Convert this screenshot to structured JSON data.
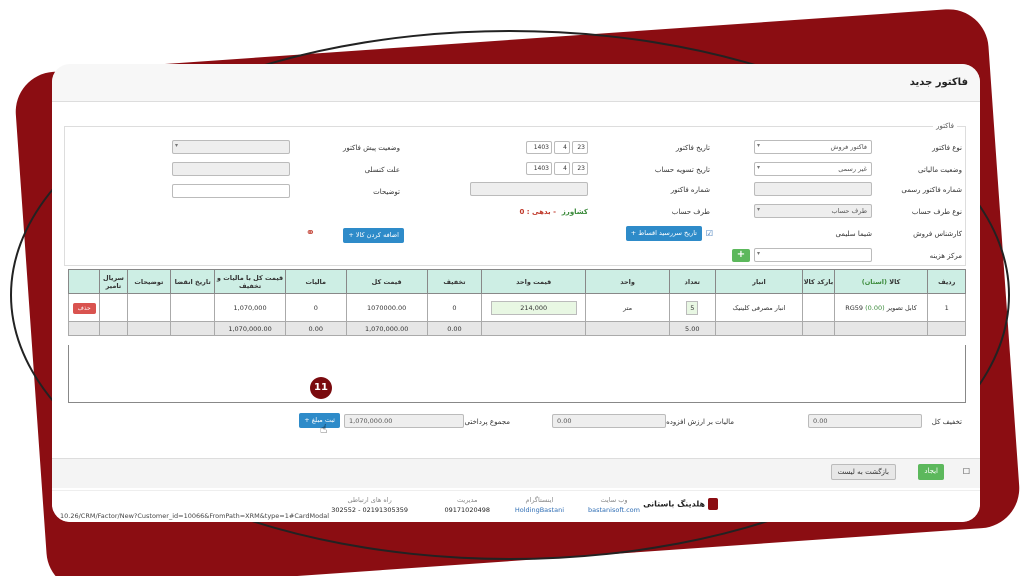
{
  "title": "فاکتور جدید",
  "section_legend": "فاکتور",
  "form": {
    "invoice_type_label": "نوع فاکتور",
    "invoice_type_value": "فاکتور فروش",
    "tax_status_label": "وضعیت مالیاتی",
    "tax_status_value": "غیر رسمی",
    "official_number_label": "شماره فاکتور رسمی",
    "party_type_label": "نوع طرف حساب",
    "party_type_value": "طرف حساب",
    "sales_expert_label": "کارشناس فروش",
    "sales_expert_value": "شیما سلیمی",
    "cost_center_label": "مرکز هزینه",
    "invoice_date_label": "تاریخ فاکتور",
    "settle_date_label": "تاریخ تسویه حساب",
    "invoice_number_label": "شماره فاکتور",
    "party_label": "طرف حساب",
    "party_value": "کشاورز",
    "party_debt": "- بدهی : 0",
    "date_day": "23",
    "date_month": "4",
    "date_year": "1403",
    "installment_button": "تاریخ سررسید اقساط",
    "pre_invoice_status_label": "وضعیت پیش فاکتور",
    "cancel_reason_label": "علت کنسلی",
    "description_label": "توضیحات",
    "add_credit_button": "اضافه کردن کالا"
  },
  "table": {
    "headers": [
      "ردیف",
      "کالا",
      "بارکد کالا",
      "انبار",
      "تعداد",
      "واحد",
      "قیمت واحد",
      "تخفیف",
      "قیمت کل",
      "مالیات",
      "قیمت کل با مالیات و تخفیف",
      "تاریخ انقضا",
      "توضیحات",
      "سریال تامیر"
    ],
    "row": {
      "index": "1",
      "product": "کابل تصویر RG59",
      "stock": "(0.00)",
      "stock_header": "(استان)",
      "warehouse": "انبار مصرفی کلینیک",
      "qty": "5",
      "unit": "متر",
      "unit_price": "214,000",
      "discount": "0",
      "total": "1070000.00",
      "tax": "0",
      "grand_total": "1,070,000",
      "delete": "حذف"
    },
    "sum": {
      "qty": "5.00",
      "discount": "0.00",
      "total": "1,070,000.00",
      "tax": "0.00",
      "grand_total": "1,070,000.00"
    }
  },
  "bottom": {
    "total_discount_label": "تخفیف کل",
    "total_discount_value": "0.00",
    "vat_label": "مالیات بر ارزش افزوده",
    "vat_value": "0.00",
    "payable_label": "مجموع پرداختی",
    "payable_value": "1,070,000.00",
    "register_button": "ثبت مبلغ",
    "step": "11"
  },
  "actions": {
    "save": "ایجاد",
    "back": "بازگشت به لیست"
  },
  "footer": {
    "company": "هلدینگ باستانی",
    "website_title": "وب سایت",
    "website_value": "bastanisoft.com",
    "instagram_title": "اینستاگرام",
    "instagram_value": "HoldingBastani",
    "management_title": "مدیریت",
    "management_value": "09171020498",
    "contact_title": "راه های ارتباطی",
    "contact_value": "02191305359 - 302552",
    "url": "10.26/CRM/Factor/New?Customer_id=10066&FromPath=XRM&type=1#CardModal"
  }
}
